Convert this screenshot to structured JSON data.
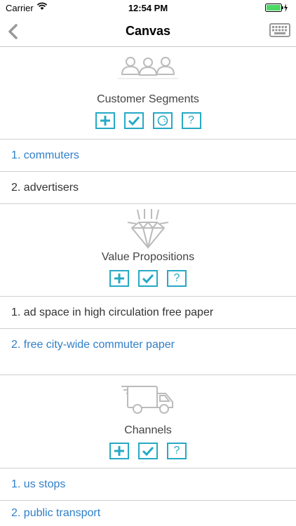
{
  "status_bar": {
    "carrier": "Carrier",
    "time": "12:54 PM",
    "battery_color": "#4cd964"
  },
  "nav": {
    "title": "Canvas"
  },
  "sections": [
    {
      "label": "Customer Segments",
      "icon": "people-icon",
      "buttons": [
        "add",
        "check",
        "emoji",
        "help"
      ],
      "items": [
        "1. commuters",
        "2. advertisers"
      ]
    },
    {
      "label": "Value Propositions",
      "icon": "diamond-icon",
      "buttons": [
        "add",
        "check",
        "help"
      ],
      "items": [
        "1. ad space in high circulation free paper",
        "2. free city-wide commuter paper"
      ]
    },
    {
      "label": "Channels",
      "icon": "truck-icon",
      "buttons": [
        "add",
        "check",
        "help"
      ],
      "items": [
        "1. us stops",
        "2. public transport"
      ]
    }
  ],
  "help_glyph": "?",
  "accent_color": "#26a9c6",
  "link_color": "#2f7fc8"
}
